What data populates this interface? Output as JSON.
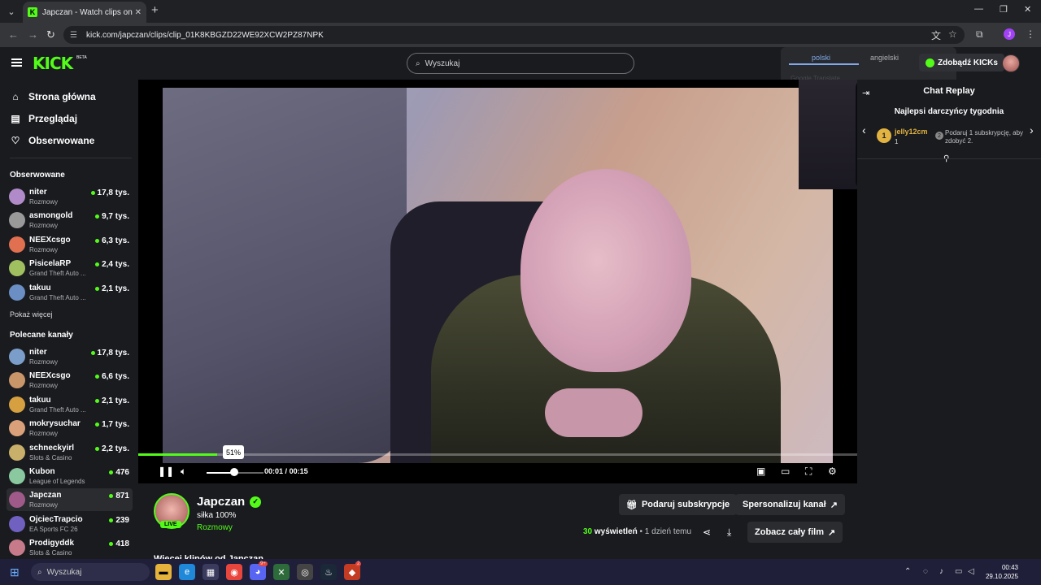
{
  "browser": {
    "tab_title": "Japczan - Watch clips on Kick",
    "url": "kick.com/japczan/clips/clip_01K8KBGZD22WE92XCW2PZ87NPK",
    "profile_initial": "J"
  },
  "header": {
    "logo": "KICK",
    "logo_badge": "BETA",
    "search_placeholder": "Wyszukaj",
    "kicks_button": "Zdobądź KICKs"
  },
  "translate_popup": {
    "lang_from": "polski",
    "lang_to": "angielski",
    "hint": "Google Translate"
  },
  "sidebar": {
    "nav": [
      {
        "label": "Strona główna",
        "icon": "home-icon"
      },
      {
        "label": "Przeglądaj",
        "icon": "browse-icon"
      },
      {
        "label": "Obserwowane",
        "icon": "heart-icon"
      }
    ],
    "followed_heading": "Obserwowane",
    "followed": [
      {
        "name": "niter",
        "category": "Rozmowy",
        "viewers": "17,8 tys."
      },
      {
        "name": "asmongold",
        "category": "Rozmowy",
        "viewers": "9,7 tys."
      },
      {
        "name": "NEEXcsgo",
        "category": "Rozmowy",
        "viewers": "6,3 tys."
      },
      {
        "name": "PisicelaRP",
        "category": "Grand Theft Auto ...",
        "viewers": "2,4 tys."
      },
      {
        "name": "takuu",
        "category": "Grand Theft Auto ...",
        "viewers": "2,1 tys."
      }
    ],
    "show_more": "Pokaż więcej",
    "recommended_heading": "Polecane kanały",
    "recommended": [
      {
        "name": "niter",
        "category": "Rozmowy",
        "viewers": "17,8 tys."
      },
      {
        "name": "NEEXcsgo",
        "category": "Rozmowy",
        "viewers": "6,6 tys."
      },
      {
        "name": "takuu",
        "category": "Grand Theft Auto ...",
        "viewers": "2,1 tys."
      },
      {
        "name": "mokrysuchar",
        "category": "Rozmowy",
        "viewers": "1,7 tys."
      },
      {
        "name": "schneckyirl",
        "category": "Slots & Casino",
        "viewers": "2,2 tys."
      },
      {
        "name": "Kubon",
        "category": "League of Legends",
        "viewers": "476"
      },
      {
        "name": "Japczan",
        "category": "Rozmowy",
        "viewers": "871"
      },
      {
        "name": "OjciecTrapcio",
        "category": "EA Sports FC 26",
        "viewers": "239"
      },
      {
        "name": "Prodigyddk",
        "category": "Slots & Casino",
        "viewers": "418"
      }
    ]
  },
  "player": {
    "progress": 0.11,
    "volume": 0.51,
    "volume_tooltip": "51%",
    "time_current": "00:01",
    "time_sep": "/",
    "time_total": "00:15"
  },
  "chat": {
    "title": "Chat Replay",
    "donors_title": "Najlepsi darczyńcy tygodnia",
    "donor_rank": "1",
    "donor_name": "jelly12cm",
    "donor_count": "1",
    "donor_gift_rank": "2",
    "donor_hint": "Podaruj 1 subskrypcję, aby zdobyć 2."
  },
  "channel": {
    "name": "Japczan",
    "live": "LIVE",
    "stream_title": "siłka 100%",
    "category": "Rozmowy",
    "gift_button": "Podaruj subskrypcje",
    "customize_button": "Spersonalizuj kanał",
    "views_count": "30",
    "views_label": "wyświetleń",
    "age": "1 dzień temu",
    "watch_full": "Zobacz cały film",
    "more_clips": "Więcej klipów od Japczan"
  },
  "taskbar": {
    "search_placeholder": "Wyszukaj",
    "time": "00:43",
    "date": "29.10.2025",
    "discord_badge": "9+",
    "app_badge": "2"
  }
}
